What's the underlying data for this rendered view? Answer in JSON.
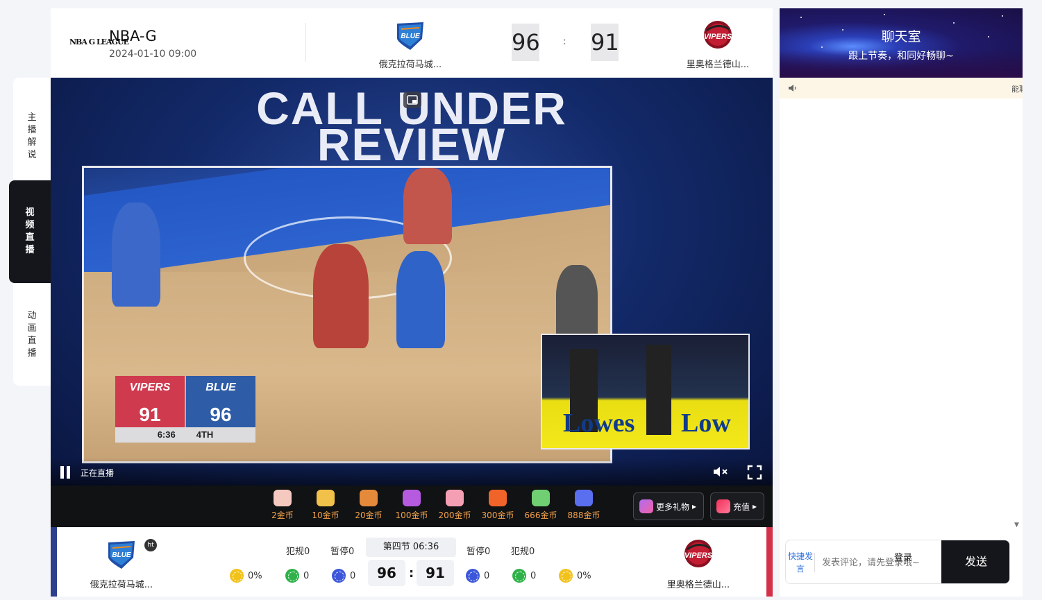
{
  "side_tabs": [
    {
      "label": "主播解说",
      "active": false
    },
    {
      "label": "视频直播",
      "active": true
    },
    {
      "label": "动画直播",
      "active": false
    }
  ],
  "header": {
    "league_logo_text": "NBA G LEAGUE",
    "league": "NBA-G",
    "datetime": "2024-01-10 09:00",
    "home_team": "俄克拉荷马城...",
    "away_team": "里奥格兰德山...",
    "home_score": "96",
    "away_score": "91",
    "colon": ":"
  },
  "video": {
    "overlay_line1": "CALL UNDER",
    "overlay_line2": "REVIEW",
    "scorebug": {
      "left_team": "VIPERS",
      "left_score": "91",
      "right_team": "BLUE",
      "right_score": "96",
      "clock": "6:36",
      "period": "4TH"
    },
    "sponsor_text": "Lowes",
    "sponsor_text_2": "Low",
    "live_label": "正在直播"
  },
  "gifts": [
    {
      "price": "2金币",
      "color": "#f6c9c0"
    },
    {
      "price": "10金币",
      "color": "#f2c14a"
    },
    {
      "price": "20金币",
      "color": "#e58a3a"
    },
    {
      "price": "100金币",
      "color": "#b65be0"
    },
    {
      "price": "200金币",
      "color": "#f59fb4"
    },
    {
      "price": "300金币",
      "color": "#f0642a"
    },
    {
      "price": "666金币",
      "color": "#6fcf72"
    },
    {
      "price": "888金币",
      "color": "#5a6ef0"
    }
  ],
  "gift_buttons": {
    "more": "更多礼物",
    "recharge": "充值"
  },
  "stats": {
    "home_team": "俄克拉荷马城...",
    "away_team": "里奥格兰德山...",
    "ht_badge": "ht",
    "period": "第四节 06:36",
    "home_score": "96",
    "away_score": "91",
    "colon": ":",
    "home_fouls": "犯规0",
    "home_timeouts": "暂停0",
    "away_timeouts": "暂停0",
    "away_fouls": "犯规0",
    "home_pct": "0%",
    "home_g": "0",
    "home_b": "0",
    "away_b": "0",
    "away_g": "0",
    "away_pct": "0%"
  },
  "chat": {
    "title": "聊天室",
    "subtitle": "跟上节奏，和同好畅聊~",
    "notice": "能聊",
    "quick_label": "快捷发言",
    "input_placeholder": "发表评论，请先登录哦~",
    "login": "登录",
    "send": "发送"
  },
  "colors": {
    "accent_dark": "#15161c",
    "home_blue": "#2c3e8c",
    "away_red": "#d3304a",
    "gift_price": "#f3a24a"
  }
}
